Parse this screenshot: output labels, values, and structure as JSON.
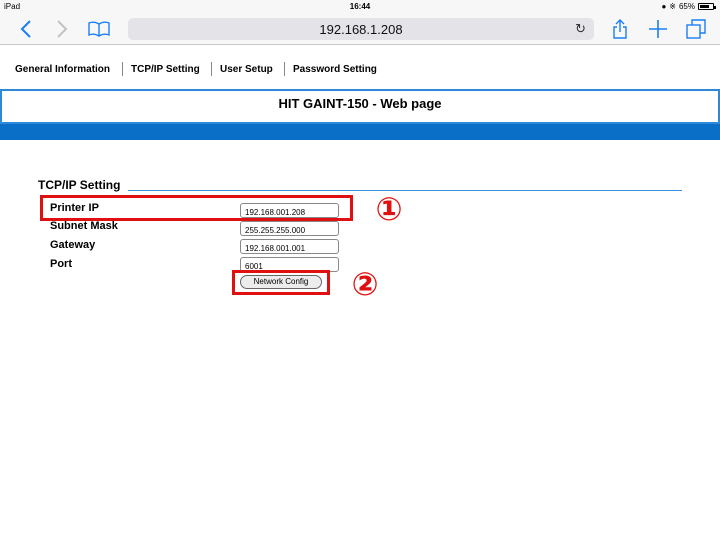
{
  "status_bar": {
    "device": "iPad",
    "time": "16:44",
    "battery": "65%",
    "battery_level": 0.65
  },
  "browser": {
    "url": "192.168.1.208",
    "back_icon": "chevron-left-icon",
    "forward_icon": "chevron-right-icon",
    "bookmarks_icon": "book-icon",
    "reload_icon": "reload-icon",
    "share_icon": "share-icon",
    "new_tab_icon": "plus-icon",
    "tabs_icon": "tabs-icon"
  },
  "nav": {
    "items": [
      "General Information",
      "TCP/IP Setting",
      "User Setup",
      "Password Setting"
    ]
  },
  "header": {
    "title": "HIT GAINT-150 - Web page"
  },
  "section": {
    "title": "TCP/IP Setting",
    "fields": [
      {
        "label": "Printer IP",
        "value": "192.168.001.208"
      },
      {
        "label": "Subnet Mask",
        "value": "255.255.255.000"
      },
      {
        "label": "Gateway",
        "value": "192.168.001.001"
      },
      {
        "label": "Port",
        "value": "6001"
      }
    ],
    "button": "Network Config"
  },
  "annotations": {
    "one": "①",
    "two": "②",
    "color": "#e01010"
  },
  "colors": {
    "accent": "#1a7ef5",
    "header_border": "#2e8ad8",
    "header_bar": "#0a6fc6"
  }
}
